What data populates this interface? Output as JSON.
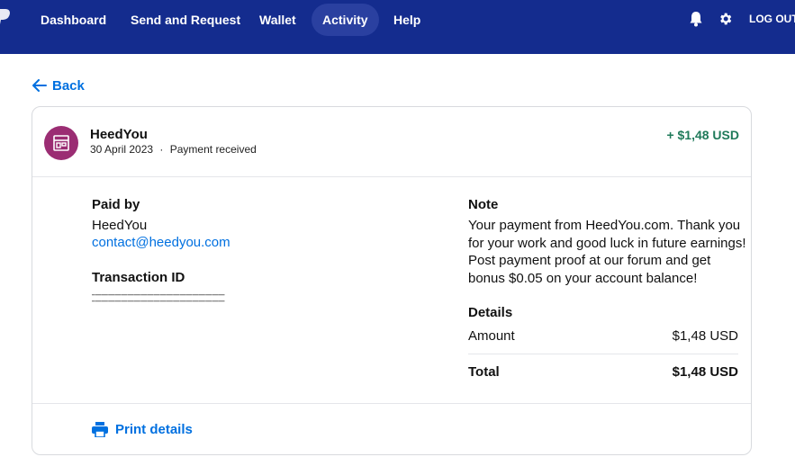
{
  "nav": {
    "items": [
      {
        "label": "Dashboard",
        "active": false
      },
      {
        "label": "Send and Request",
        "active": false
      },
      {
        "label": "Wallet",
        "active": false
      },
      {
        "label": "Activity",
        "active": true
      },
      {
        "label": "Help",
        "active": false
      }
    ],
    "logout_label": "LOG OUT",
    "icons": [
      "bell-icon",
      "gear-icon"
    ]
  },
  "back_label": "Back",
  "transaction": {
    "merchant": "HeedYou",
    "date": "30 April 2023",
    "separator": "·",
    "status": "Payment received",
    "amount": "+ $1,48 USD",
    "paid_by_label": "Paid by",
    "paid_by_name": "HeedYou",
    "paid_by_email": "contact@heedyou.com",
    "transaction_id_label": "Transaction ID",
    "note_label": "Note",
    "note_text": "Your payment from HeedYou.com. Thank you for your work and good luck in future earnings! Post payment proof at our forum and get bonus $0.05 on your account balance!",
    "details_label": "Details",
    "amount_label": "Amount",
    "amount_value": "$1,48 USD",
    "total_label": "Total",
    "total_value": "$1,48 USD"
  },
  "print_label": "Print details",
  "colors": {
    "nav_bg": "#142c8e",
    "nav_active": "#2a40a0",
    "link": "#0070e0",
    "positive": "#1f7a5a",
    "merchant_icon_bg": "#9b2d73"
  }
}
